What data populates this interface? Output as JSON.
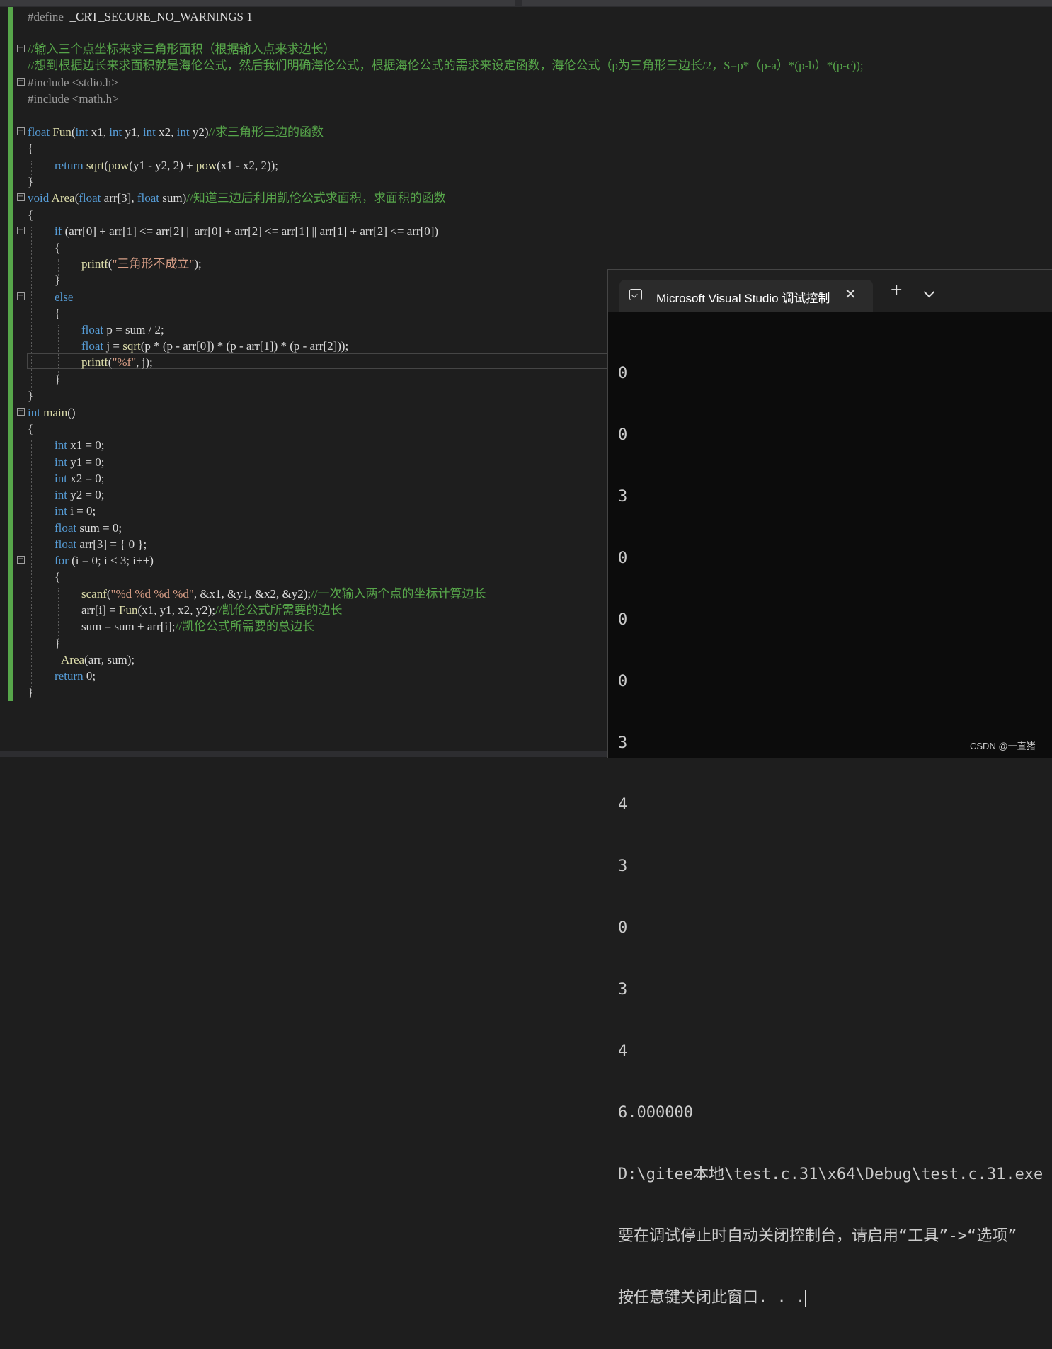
{
  "editor": {
    "lines": {
      "l1_a": "#define",
      "l1_b": "_CRT_SECURE_NO_WARNINGS 1",
      "l3": "//输入三个点坐标来求三角形面积（根据输入点来求边长）",
      "l4": "//想到根据边长来求面积就是海伦公式，然后我们明确海伦公式，根据海伦公式的需求来设定函数，海伦公式（p为三角形三边长/2，S=p*（p-a）*(p-b）*(p-c));",
      "l5": "#include <stdio.h>",
      "l6": "#include <math.h>",
      "l8_kw1": "float",
      "l8_fn": "Fun",
      "l8_a": "(",
      "l8_kw2": "int",
      "l8_b": " x1, ",
      "l8_kw3": "int",
      "l8_c": " y1, ",
      "l8_kw4": "int",
      "l8_d": " x2, ",
      "l8_kw5": "int",
      "l8_e": " y2)",
      "l8_cm": "//求三角形三边的函数",
      "brace_open": "{",
      "brace_close": "}",
      "l10_kw": "return",
      "l10_sp": " ",
      "l10_fn1": "sqrt",
      "l10_a": "(",
      "l10_fn2": "pow",
      "l10_b": "(y1 - y2, 2) + ",
      "l10_fn3": "pow",
      "l10_c": "(x1 - x2, 2));",
      "l12_kw1": "void",
      "l12_sp": " ",
      "l12_fn": "Area",
      "l12_a": "(",
      "l12_kw2": "float",
      "l12_b": " arr[3], ",
      "l12_kw3": "float",
      "l12_c": " sum)",
      "l12_cm": "//知道三边后利用凯伦公式求面积，求面积的函数",
      "l14_kw": "if",
      "l14_rest": " (arr[0] + arr[1] <= arr[2] || arr[0] + arr[2] <= arr[1] || arr[1] + arr[2] <= arr[0])",
      "l16_fn": "printf",
      "l16_a": "(",
      "l16_st": "\"三角形不成立\"",
      "l16_b": ");",
      "l18_kw": "else",
      "l20_kw": "float",
      "l20_rest": " p = sum / 2;",
      "l21_kw": "float",
      "l21_a": " j = ",
      "l21_fn": "sqrt",
      "l21_b": "(p * (p - arr[0]) * (p - arr[1]) * (p - arr[2]));",
      "l22_fn": "printf",
      "l22_a": "(",
      "l22_st": "\"%f\"",
      "l22_b": ", j);",
      "l25_kw": "int",
      "l25_sp": " ",
      "l25_fn": "main",
      "l25_rest": "()",
      "l27_kw": "int",
      "l27_rest": " x1 = 0;",
      "l28_kw": "int",
      "l28_rest": " y1 = 0;",
      "l29_kw": "int",
      "l29_rest": " x2 = 0;",
      "l30_kw": "int",
      "l30_rest": " y2 = 0;",
      "l31_kw": "int",
      "l31_rest": " i = 0;",
      "l32_kw": "float",
      "l32_rest": " sum = 0;",
      "l33_kw": "float",
      "l33_rest": " arr[3] = { 0 };",
      "l34_kw": "for",
      "l34_rest": " (i = 0; i < 3; i++)",
      "l36_fn": "scanf",
      "l36_a": "(",
      "l36_st": "\"%d %d %d %d\"",
      "l36_b": ", &x1, &y1, &x2, &y2);",
      "l36_cm": "//一次输入两个点的坐标计算边长",
      "l37_a": "arr[i] = ",
      "l37_fn": "Fun",
      "l37_b": "(x1, y1, x2, y2);",
      "l37_cm": "//凯伦公式所需要的边长",
      "l38_a": "sum = sum + arr[i];",
      "l38_cm": "//凯伦公式所需要的总边长",
      "l40_fn": "Area",
      "l40_rest": "(arr, sum);",
      "l41_kw": "return",
      "l41_rest": " 0;"
    }
  },
  "console": {
    "tab_title": "Microsoft Visual Studio 调试控制台",
    "close_label": "✕",
    "plus_label": "+",
    "output": [
      "0",
      "0",
      "3",
      "0",
      "0",
      "0",
      "3",
      "4",
      "3",
      "0",
      "3",
      "4",
      "6.000000",
      "D:\\gitee本地\\test.c.31\\x64\\Debug\\test.c.31.exe",
      "要在调试停止时自动关闭控制台，请启用“工具”->“选项”",
      "按任意键关闭此窗口. . ."
    ]
  },
  "watermark": "CSDN @一直猪",
  "colors": {
    "keyword": "#569cd6",
    "function": "#dcdcaa",
    "comment": "#57a64a",
    "string": "#d69d85",
    "background": "#1e1e1e",
    "console_bg": "#0c0c0c"
  }
}
